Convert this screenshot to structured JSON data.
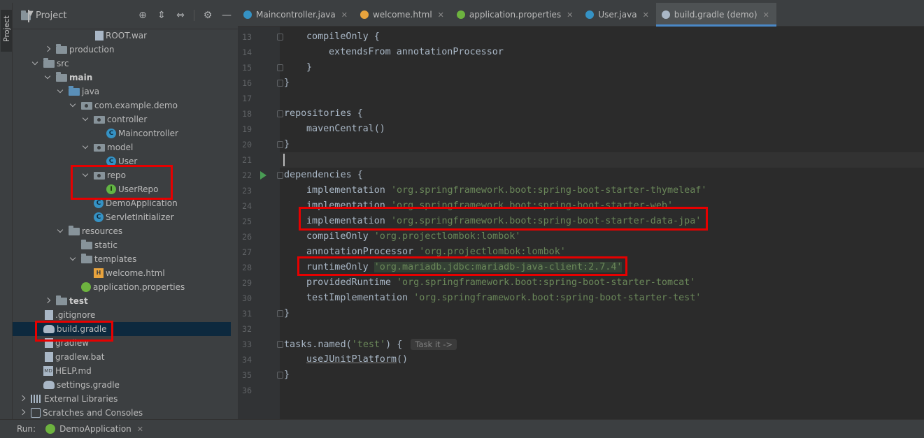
{
  "toolstrip": {
    "project_label": "Project"
  },
  "project_panel": {
    "title": "Project",
    "tree": [
      {
        "label": "ROOT.war",
        "depth": 5,
        "arrow": "none",
        "icon": "file"
      },
      {
        "label": "production",
        "depth": 2,
        "arrow": "right",
        "icon": "folder"
      },
      {
        "label": "src",
        "depth": 1,
        "arrow": "down",
        "icon": "folder"
      },
      {
        "label": "main",
        "depth": 2,
        "arrow": "down",
        "icon": "folder",
        "bold": true
      },
      {
        "label": "java",
        "depth": 3,
        "arrow": "down",
        "icon": "folder-blue"
      },
      {
        "label": "com.example.demo",
        "depth": 4,
        "arrow": "down",
        "icon": "pkg"
      },
      {
        "label": "controller",
        "depth": 5,
        "arrow": "down",
        "icon": "pkg"
      },
      {
        "label": "Maincontroller",
        "depth": 6,
        "arrow": "none",
        "icon": "class"
      },
      {
        "label": "model",
        "depth": 5,
        "arrow": "down",
        "icon": "pkg"
      },
      {
        "label": "User",
        "depth": 6,
        "arrow": "none",
        "icon": "class"
      },
      {
        "label": "repo",
        "depth": 5,
        "arrow": "down",
        "icon": "pkg"
      },
      {
        "label": "UserRepo",
        "depth": 6,
        "arrow": "none",
        "icon": "iface"
      },
      {
        "label": "DemoApplication",
        "depth": 5,
        "arrow": "none",
        "icon": "class"
      },
      {
        "label": "ServletInitializer",
        "depth": 5,
        "arrow": "none",
        "icon": "class"
      },
      {
        "label": "resources",
        "depth": 3,
        "arrow": "down",
        "icon": "folder"
      },
      {
        "label": "static",
        "depth": 4,
        "arrow": "none",
        "icon": "folder"
      },
      {
        "label": "templates",
        "depth": 4,
        "arrow": "down",
        "icon": "folder"
      },
      {
        "label": "welcome.html",
        "depth": 5,
        "arrow": "none",
        "icon": "html"
      },
      {
        "label": "application.properties",
        "depth": 4,
        "arrow": "none",
        "icon": "spring"
      },
      {
        "label": "test",
        "depth": 2,
        "arrow": "right",
        "icon": "folder",
        "bold": true
      },
      {
        "label": ".gitignore",
        "depth": 1,
        "arrow": "none",
        "icon": "file"
      },
      {
        "label": "build.gradle",
        "depth": 1,
        "arrow": "none",
        "icon": "gradle",
        "selected": true
      },
      {
        "label": "gradlew",
        "depth": 1,
        "arrow": "none",
        "icon": "file"
      },
      {
        "label": "gradlew.bat",
        "depth": 1,
        "arrow": "none",
        "icon": "file"
      },
      {
        "label": "HELP.md",
        "depth": 1,
        "arrow": "none",
        "icon": "md"
      },
      {
        "label": "settings.gradle",
        "depth": 1,
        "arrow": "none",
        "icon": "gradle"
      },
      {
        "label": "External Libraries",
        "depth": 0,
        "arrow": "right",
        "icon": "libs"
      },
      {
        "label": "Scratches and Consoles",
        "depth": 0,
        "arrow": "right",
        "icon": "scratch"
      }
    ]
  },
  "tabs": [
    {
      "label": "Maincontroller.java",
      "icon": "class-icon",
      "color": "#3592c4",
      "active": false
    },
    {
      "label": "welcome.html",
      "icon": "html-icon",
      "color": "#e8a33d",
      "active": false
    },
    {
      "label": "application.properties",
      "icon": "spring-icon",
      "color": "#6db33f",
      "active": false
    },
    {
      "label": "User.java",
      "icon": "class-icon",
      "color": "#3592c4",
      "active": false
    },
    {
      "label": "build.gradle (demo)",
      "icon": "gradle-icon",
      "color": "#a9b7c6",
      "active": true
    }
  ],
  "editor": {
    "lines": [
      {
        "n": "13",
        "indent": 1,
        "parts": [
          {
            "t": "compileOnly {"
          }
        ],
        "fold": true
      },
      {
        "n": "14",
        "indent": 2,
        "parts": [
          {
            "t": "extendsFrom annotationProcessor"
          }
        ]
      },
      {
        "n": "15",
        "indent": 1,
        "parts": [
          {
            "t": "}"
          }
        ],
        "fold": true
      },
      {
        "n": "16",
        "indent": 0,
        "parts": [
          {
            "t": "}"
          }
        ],
        "fold": true
      },
      {
        "n": "17",
        "indent": 0,
        "parts": []
      },
      {
        "n": "18",
        "indent": 0,
        "parts": [
          {
            "t": "repositories {"
          }
        ],
        "fold": true
      },
      {
        "n": "19",
        "indent": 1,
        "parts": [
          {
            "t": "mavenCentral()"
          }
        ]
      },
      {
        "n": "20",
        "indent": 0,
        "parts": [
          {
            "t": "}"
          }
        ],
        "fold": true
      },
      {
        "n": "21",
        "indent": 0,
        "parts": [],
        "current": true
      },
      {
        "n": "22",
        "indent": 0,
        "parts": [
          {
            "t": "dependencies {"
          }
        ],
        "fold": true,
        "run": true
      },
      {
        "n": "23",
        "indent": 1,
        "parts": [
          {
            "t": "implementation "
          },
          {
            "t": "'org.springframework.boot:spring-boot-starter-thymeleaf'",
            "c": "str"
          }
        ]
      },
      {
        "n": "24",
        "indent": 1,
        "parts": [
          {
            "t": "implementation "
          },
          {
            "t": "'org.springframework.boot:spring-boot-starter-web'",
            "c": "str"
          }
        ]
      },
      {
        "n": "25",
        "indent": 1,
        "parts": [
          {
            "t": "implementation "
          },
          {
            "t": "'org.springframework.boot:spring-boot-starter-data-jpa'",
            "c": "str"
          }
        ]
      },
      {
        "n": "26",
        "indent": 1,
        "parts": [
          {
            "t": "compileOnly "
          },
          {
            "t": "'org.projectlombok:lombok'",
            "c": "str"
          }
        ]
      },
      {
        "n": "27",
        "indent": 1,
        "parts": [
          {
            "t": "annotationProcessor "
          },
          {
            "t": "'org.projectlombok:lombok'",
            "c": "str"
          }
        ]
      },
      {
        "n": "28",
        "indent": 1,
        "parts": [
          {
            "t": "runtimeOnly "
          },
          {
            "t": "'org.mariadb.jdbc:mariadb-java-client:2.7.4'",
            "c": "str hl"
          }
        ]
      },
      {
        "n": "29",
        "indent": 1,
        "parts": [
          {
            "t": "providedRuntime "
          },
          {
            "t": "'org.springframework.boot:spring-boot-starter-tomcat'",
            "c": "str"
          }
        ]
      },
      {
        "n": "30",
        "indent": 1,
        "parts": [
          {
            "t": "testImplementation "
          },
          {
            "t": "'org.springframework.boot:spring-boot-starter-test'",
            "c": "str"
          }
        ]
      },
      {
        "n": "31",
        "indent": 0,
        "parts": [
          {
            "t": "}"
          }
        ],
        "fold": true
      },
      {
        "n": "32",
        "indent": 0,
        "parts": []
      },
      {
        "n": "33",
        "indent": 0,
        "parts": [
          {
            "t": "tasks.named("
          },
          {
            "t": "'test'",
            "c": "str"
          },
          {
            "t": ") { "
          },
          {
            "t": "Task it ->",
            "c": "hint"
          }
        ],
        "fold": true
      },
      {
        "n": "34",
        "indent": 1,
        "parts": [
          {
            "t": "useJUnitPlatform",
            "c": "ul"
          },
          {
            "t": "()"
          }
        ]
      },
      {
        "n": "35",
        "indent": 0,
        "parts": [
          {
            "t": "}"
          }
        ],
        "fold": true
      },
      {
        "n": "36",
        "indent": 0,
        "parts": []
      }
    ]
  },
  "runbar": {
    "label": "Run:",
    "config": "DemoApplication"
  }
}
